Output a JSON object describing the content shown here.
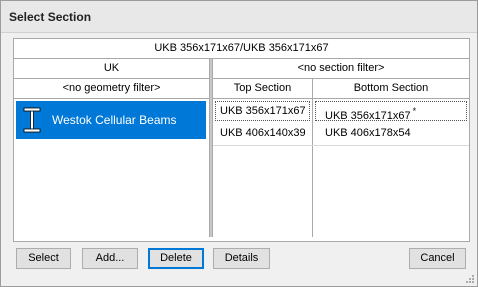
{
  "window": {
    "title": "Select Section"
  },
  "header": {
    "current": "UKB 356x171x67/UKB 356x171x67"
  },
  "left": {
    "column_header": "UK",
    "filter": "<no geometry filter>",
    "items": [
      {
        "label": "Westok Cellular Beams",
        "selected": true,
        "icon": "i-beam-icon"
      }
    ]
  },
  "right": {
    "column_header": "<no section filter>",
    "col_top": "Top Section",
    "col_bottom": "Bottom Section",
    "rows": [
      {
        "top": "UKB 356x171x67",
        "bottom": "UKB 356x171x67",
        "marker": "*"
      },
      {
        "top": "UKB 406x140x39",
        "bottom": "UKB 406x178x54",
        "marker": ""
      }
    ]
  },
  "buttons": {
    "select": "Select",
    "add": "Add...",
    "delete": "Delete",
    "details": "Details",
    "cancel": "Cancel"
  },
  "colors": {
    "selection": "#0078d7",
    "default_button_border": "#0078d7"
  }
}
